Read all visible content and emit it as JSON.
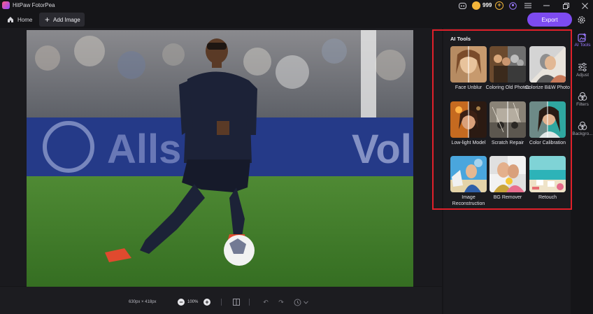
{
  "app": {
    "title": "HitPaw FotorPea",
    "coins": "999"
  },
  "toolbar": {
    "home_label": "Home",
    "add_image_label": "Add Image",
    "export_label": "Export"
  },
  "canvas": {
    "image_dimensions": "630px × 418px",
    "zoom": "100%"
  },
  "ai_tools": {
    "title": "AI Tools",
    "items": [
      {
        "label": "Face Unblur"
      },
      {
        "label": "Coloring Old Photos"
      },
      {
        "label": "Colorize B&W Photo"
      },
      {
        "label": "Low-light Model"
      },
      {
        "label": "Scratch Repair"
      },
      {
        "label": "Color Calibration"
      },
      {
        "label": "Image Reconstruction"
      },
      {
        "label": "BG Remover"
      },
      {
        "label": "Retouch"
      }
    ]
  },
  "rail": {
    "items": [
      {
        "label": "AI Tools",
        "icon": "ai-tools-icon",
        "active": true
      },
      {
        "label": "Adjust",
        "icon": "sliders-icon"
      },
      {
        "label": "Filters",
        "icon": "filters-icon"
      },
      {
        "label": "Backgro...",
        "icon": "background-icon"
      }
    ]
  },
  "colors": {
    "accent": "#7d4bf0",
    "highlight": "#e0202a",
    "coin": "#f3b53a"
  }
}
